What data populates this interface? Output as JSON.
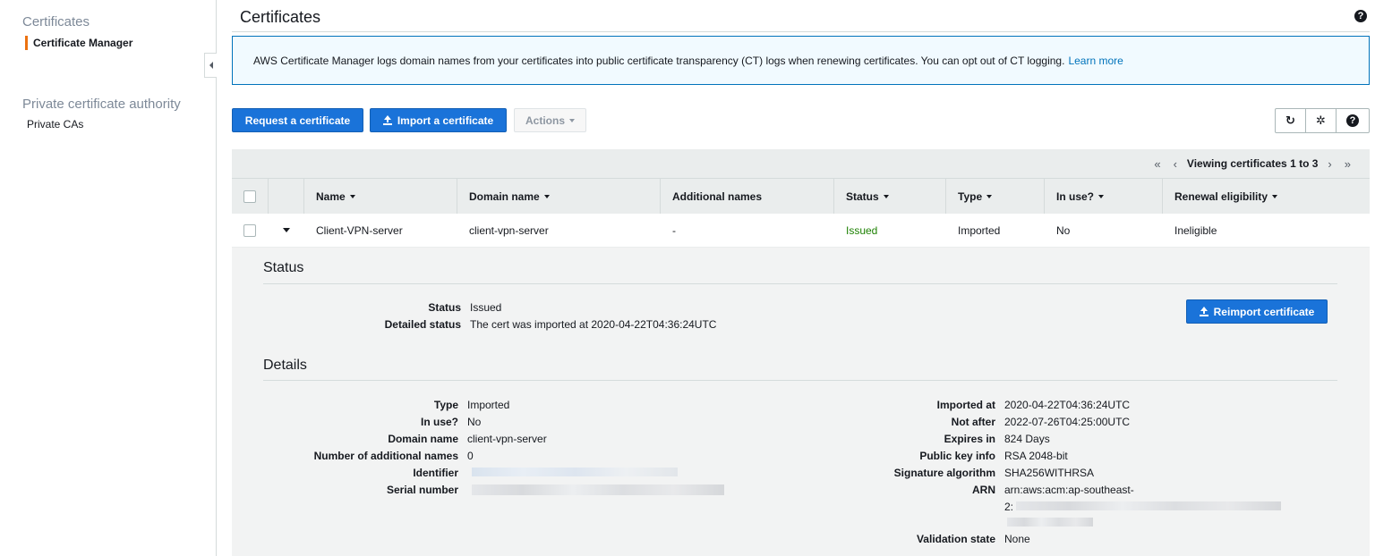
{
  "sidebar": {
    "section1": "Certificates",
    "item_active": "Certificate Manager",
    "section2": "Private certificate authority",
    "item2": "Private CAs"
  },
  "header": {
    "title": "Certificates"
  },
  "banner": {
    "text": "AWS Certificate Manager logs domain names from your certificates into public certificate transparency (CT) logs when renewing certificates. You can opt out of CT logging.",
    "link": "Learn more"
  },
  "toolbar": {
    "request_label": "Request a certificate",
    "import_label": "Import a certificate",
    "actions_label": "Actions"
  },
  "icons": {
    "refresh": "refresh-icon",
    "settings": "gear-icon",
    "help": "help-icon"
  },
  "pager": {
    "first": "«",
    "prev": "‹",
    "text": "Viewing certificates 1 to 3",
    "next": "›",
    "last": "»"
  },
  "table": {
    "columns": [
      "Name",
      "Domain name",
      "Additional names",
      "Status",
      "Type",
      "In use?",
      "Renewal eligibility"
    ],
    "row": {
      "name": "Client-VPN-server",
      "domain": "client-vpn-server",
      "additional": "-",
      "status": "Issued",
      "type": "Imported",
      "in_use": "No",
      "renewal": "Ineligible"
    }
  },
  "status_section": {
    "title": "Status",
    "status_label": "Status",
    "status_value": "Issued",
    "detailed_label": "Detailed status",
    "detailed_value": "The cert was imported at 2020-04-22T04:36:24UTC",
    "reimport_label": "Reimport certificate"
  },
  "details_section": {
    "title": "Details",
    "left": [
      {
        "k": "Type",
        "v": "Imported"
      },
      {
        "k": "In use?",
        "v": "No"
      },
      {
        "k": "Domain name",
        "v": "client-vpn-server"
      },
      {
        "k": "Number of additional names",
        "v": "0"
      },
      {
        "k": "Identifier",
        "v": ""
      },
      {
        "k": "Serial number",
        "v": ""
      }
    ],
    "right": [
      {
        "k": "Imported at",
        "v": "2020-04-22T04:36:24UTC"
      },
      {
        "k": "Not after",
        "v": "2022-07-26T04:25:00UTC"
      },
      {
        "k": "Expires in",
        "v": "824 Days"
      },
      {
        "k": "Public key info",
        "v": "RSA 2048-bit"
      },
      {
        "k": "Signature algorithm",
        "v": "SHA256WITHRSA"
      },
      {
        "k": "ARN",
        "v": "arn:aws:acm:ap-southeast-"
      },
      {
        "k": "",
        "v": "2:"
      },
      {
        "k": "Validation state",
        "v": "None"
      }
    ]
  }
}
